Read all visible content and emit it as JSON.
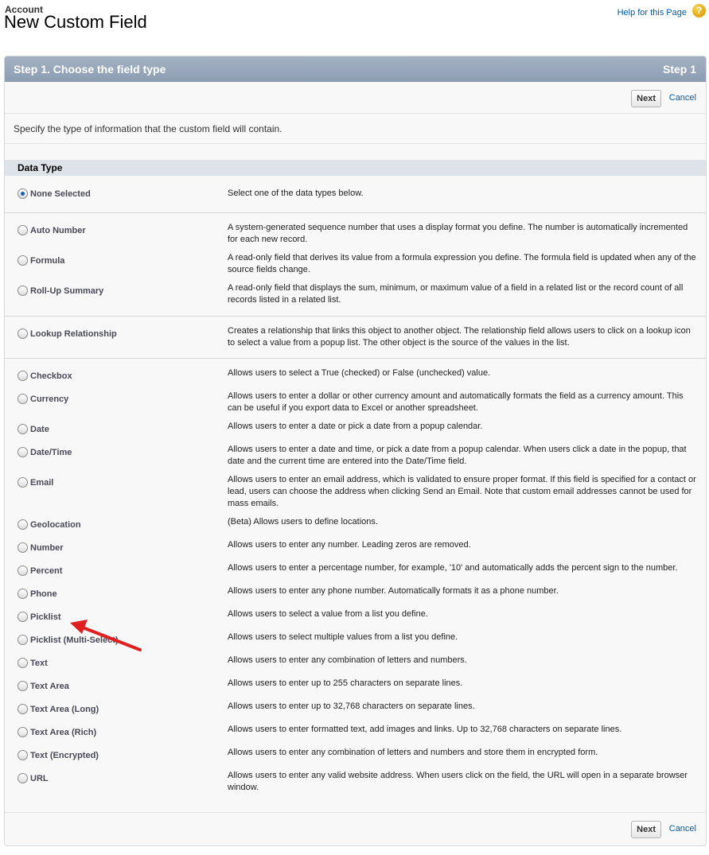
{
  "header": {
    "breadcrumb": "Account",
    "title": "New Custom Field",
    "help_link": "Help for this Page",
    "help_icon": "?"
  },
  "step": {
    "title": "Step 1. Choose the field type",
    "number": "Step 1"
  },
  "buttons": {
    "next": "Next",
    "cancel": "Cancel"
  },
  "instructions": "Specify the type of information that the custom field will contain.",
  "section_title": "Data Type",
  "data_types": [
    {
      "label": "None Selected",
      "desc": "Select one of the data types below.",
      "checked": true
    },
    {
      "label": "Auto Number",
      "desc": "A system-generated sequence number that uses a display format you define. The number is automatically incremented for each new record."
    },
    {
      "label": "Formula",
      "desc": "A read-only field that derives its value from a formula expression you define. The formula field is updated when any of the source fields change."
    },
    {
      "label": "Roll-Up Summary",
      "desc": "A read-only field that displays the sum, minimum, or maximum value of a field in a related list or the record count of all records listed in a related list."
    },
    {
      "label": "Lookup Relationship",
      "desc": "Creates a relationship that links this object to another object. The relationship field allows users to click on a lookup icon to select a value from a popup list. The other object is the source of the values in the list."
    },
    {
      "label": "Checkbox",
      "desc": "Allows users to select a True (checked) or False (unchecked) value."
    },
    {
      "label": "Currency",
      "desc": "Allows users to enter a dollar or other currency amount and automatically formats the field as a currency amount. This can be useful if you export data to Excel or another spreadsheet."
    },
    {
      "label": "Date",
      "desc": "Allows users to enter a date or pick a date from a popup calendar."
    },
    {
      "label": "Date/Time",
      "desc": "Allows users to enter a date and time, or pick a date from a popup calendar. When users click a date in the popup, that date and the current time are entered into the Date/Time field."
    },
    {
      "label": "Email",
      "desc": "Allows users to enter an email address, which is validated to ensure proper format. If this field is specified for a contact or lead, users can choose the address when clicking Send an Email. Note that custom email addresses cannot be used for mass emails."
    },
    {
      "label": "Geolocation",
      "desc": "(Beta) Allows users to define locations."
    },
    {
      "label": "Number",
      "desc": "Allows users to enter any number. Leading zeros are removed."
    },
    {
      "label": "Percent",
      "desc": "Allows users to enter a percentage number, for example, '10' and automatically adds the percent sign to the number."
    },
    {
      "label": "Phone",
      "desc": "Allows users to enter any phone number. Automatically formats it as a phone number."
    },
    {
      "label": "Picklist",
      "desc": "Allows users to select a value from a list you define."
    },
    {
      "label": "Picklist (Multi-Select)",
      "desc": "Allows users to select multiple values from a list you define."
    },
    {
      "label": "Text",
      "desc": "Allows users to enter any combination of letters and numbers."
    },
    {
      "label": "Text Area",
      "desc": "Allows users to enter up to 255 characters on separate lines."
    },
    {
      "label": "Text Area (Long)",
      "desc": "Allows users to enter up to 32,768 characters on separate lines."
    },
    {
      "label": "Text Area (Rich)",
      "desc": "Allows users to enter formatted text, add images and links. Up to 32,768 characters on separate lines."
    },
    {
      "label": "Text (Encrypted)",
      "desc": "Allows users to enter any combination of letters and numbers and store them in encrypted form."
    },
    {
      "label": "URL",
      "desc": "Allows users to enter any valid website address. When users click on the field, the URL will open in a separate browser window."
    }
  ],
  "annotation": {
    "arrow_color": "#e02020"
  }
}
